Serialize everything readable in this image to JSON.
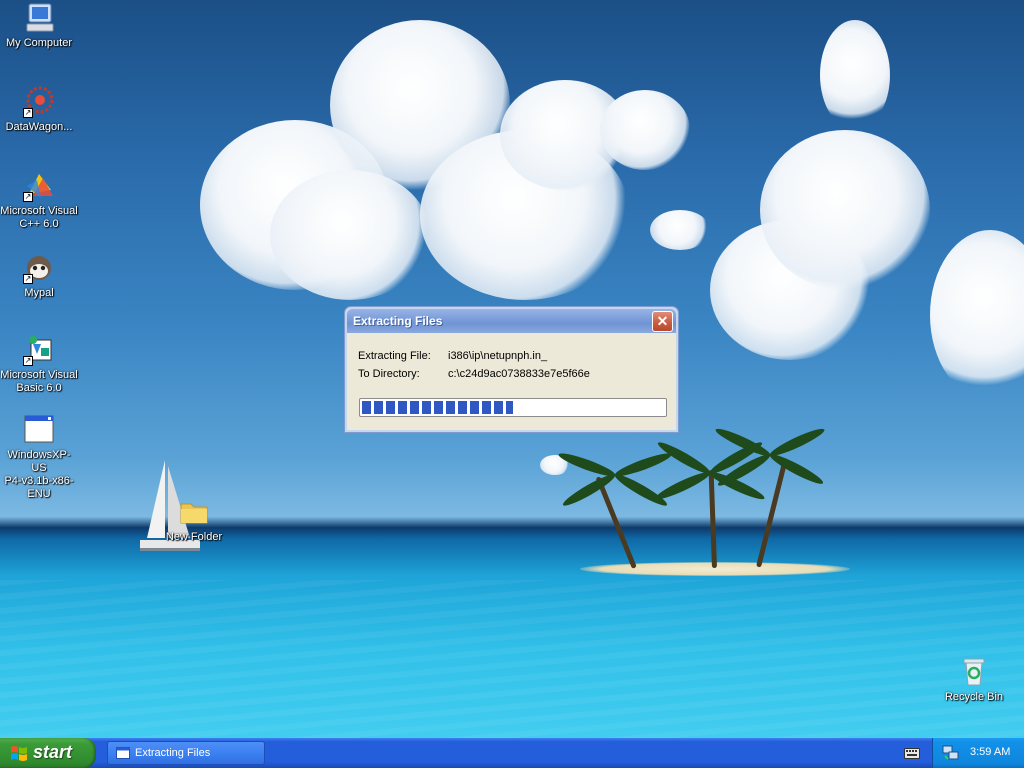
{
  "desktop": {
    "icons": [
      {
        "label": "My Computer"
      },
      {
        "label": "DataWagon..."
      },
      {
        "label": "Microsoft Visual\nC++ 6.0"
      },
      {
        "label": "Mypal"
      },
      {
        "label": "Microsoft Visual\nBasic 6.0"
      },
      {
        "label": "WindowsXP-US\nP4-v3.1b-x86-\nENU"
      },
      {
        "label": "New Folder"
      },
      {
        "label": "Recycle Bin"
      }
    ]
  },
  "dialog": {
    "title": "Extracting Files",
    "close_label": "✕",
    "extracting_label": "Extracting File:",
    "extracting_value": "i386\\ip\\netupnph.in_",
    "directory_label": "To Directory:",
    "directory_value": "c:\\c24d9ac0738833e7e5f66e",
    "progress_fraction": 0.5
  },
  "taskbar": {
    "start_label": "start",
    "task_label": "Extracting Files",
    "clock": "3:59 AM"
  },
  "colors": {
    "taskbar_blue": "#245edb",
    "start_green": "#3a9b38",
    "progress_blue": "#2f58c4",
    "dialog_face": "#ece9d8"
  },
  "icons": [
    "computer-icon",
    "datawagon-icon",
    "visual-cpp-icon",
    "mypal-icon",
    "visual-basic-icon",
    "window-icon",
    "folder-icon",
    "recycle-bin-icon",
    "windows-flag-icon",
    "keyboard-icon",
    "network-icon"
  ]
}
